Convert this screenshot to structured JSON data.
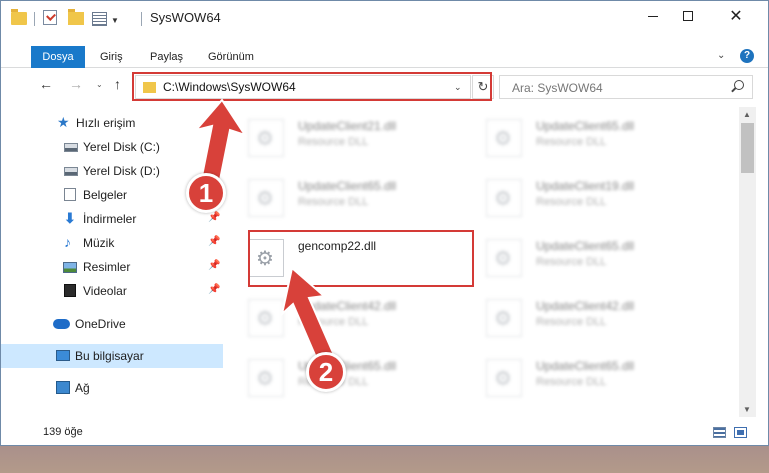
{
  "window": {
    "title": "SysWOW64",
    "controls": {
      "minimize": "",
      "maximize": "",
      "close": "✕"
    }
  },
  "ribbon": {
    "tabs": [
      {
        "label": "Dosya",
        "active": true
      },
      {
        "label": "Giriş"
      },
      {
        "label": "Paylaş"
      },
      {
        "label": "Görünüm"
      }
    ],
    "help": "?"
  },
  "nav": {
    "address": "C:\\Windows\\SysWOW64",
    "search_placeholder": "Ara: SysWOW64"
  },
  "sidebar": {
    "items": [
      {
        "label": "Hızlı erişim",
        "icon": "star-icon"
      },
      {
        "label": "Yerel Disk (C:)",
        "icon": "drive-icon"
      },
      {
        "label": "Yerel Disk (D:)",
        "icon": "drive-icon"
      },
      {
        "label": "Belgeler",
        "icon": "documents-icon"
      },
      {
        "label": "İndirmeler",
        "icon": "downloads-icon"
      },
      {
        "label": "Müzik",
        "icon": "music-icon"
      },
      {
        "label": "Resimler",
        "icon": "pictures-icon"
      },
      {
        "label": "Videolar",
        "icon": "videos-icon"
      },
      {
        "label": "OneDrive",
        "icon": "cloud-icon"
      },
      {
        "label": "Bu bilgisayar",
        "icon": "computer-icon",
        "selected": true
      },
      {
        "label": "Ağ",
        "icon": "network-icon"
      }
    ]
  },
  "files": {
    "left": [
      {
        "name": "UpdateClient21.dll",
        "desc": "Resource DLL"
      },
      {
        "name": "UpdateClient65.dll",
        "desc": "Resource DLL"
      },
      {
        "name": "gencomp22.dll",
        "desc": ""
      },
      {
        "name": "UpdateClient42.dll",
        "desc": "Resource DLL"
      },
      {
        "name": "UpdateClient65.dll",
        "desc": "Resource DLL"
      }
    ],
    "right": [
      {
        "name": "UpdateClient65.dll",
        "desc": "Resource DLL"
      },
      {
        "name": "UpdateClient19.dll",
        "desc": "Resource DLL"
      },
      {
        "name": "UpdateClient65.dll",
        "desc": "Resource DLL"
      },
      {
        "name": "UpdateClient42.dll",
        "desc": "Resource DLL"
      },
      {
        "name": "UpdateClient65.dll",
        "desc": "Resource DLL"
      }
    ]
  },
  "status": {
    "count": "139 öğe"
  },
  "annotations": {
    "badge_1": "1",
    "badge_2": "2",
    "color": "#d8413a"
  }
}
